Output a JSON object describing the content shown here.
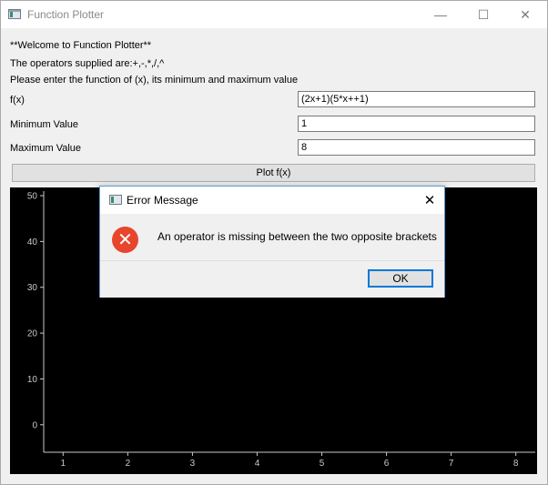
{
  "window": {
    "title": "Function Plotter",
    "minimize_glyph": "—",
    "maximize_glyph": "☐",
    "close_glyph": "✕"
  },
  "intro": {
    "welcome": "**Welcome to Function Plotter**",
    "operators": "The operators supplied are:+,-,*,/,^",
    "instructions": "Please enter the function of (x), its minimum and maximum value"
  },
  "form": {
    "fx_label": "f(x)",
    "fx_value": "(2x+1)(5*x++1)",
    "min_label": "Minimum Value",
    "min_value": "1",
    "max_label": "Maximum Value",
    "max_value": "8",
    "plot_label": "Plot f(x)"
  },
  "chart_data": {
    "type": "line",
    "x_ticks": [
      "1",
      "2",
      "3",
      "4",
      "5",
      "6",
      "7",
      "8"
    ],
    "y_ticks": [
      "0",
      "10",
      "20",
      "30",
      "40",
      "50"
    ],
    "xlim": [
      0.7,
      8.3
    ],
    "ylim": [
      -6,
      51
    ],
    "series": [],
    "background": "#000000",
    "axis_color": "#c8c8c8"
  },
  "dialog": {
    "title": "Error Message",
    "close_glyph": "✕",
    "error_glyph": "✕",
    "message": "An operator is missing between the two opposite brackets",
    "ok_label": "OK",
    "accent": "#0078d7",
    "error_color": "#e8452c"
  }
}
